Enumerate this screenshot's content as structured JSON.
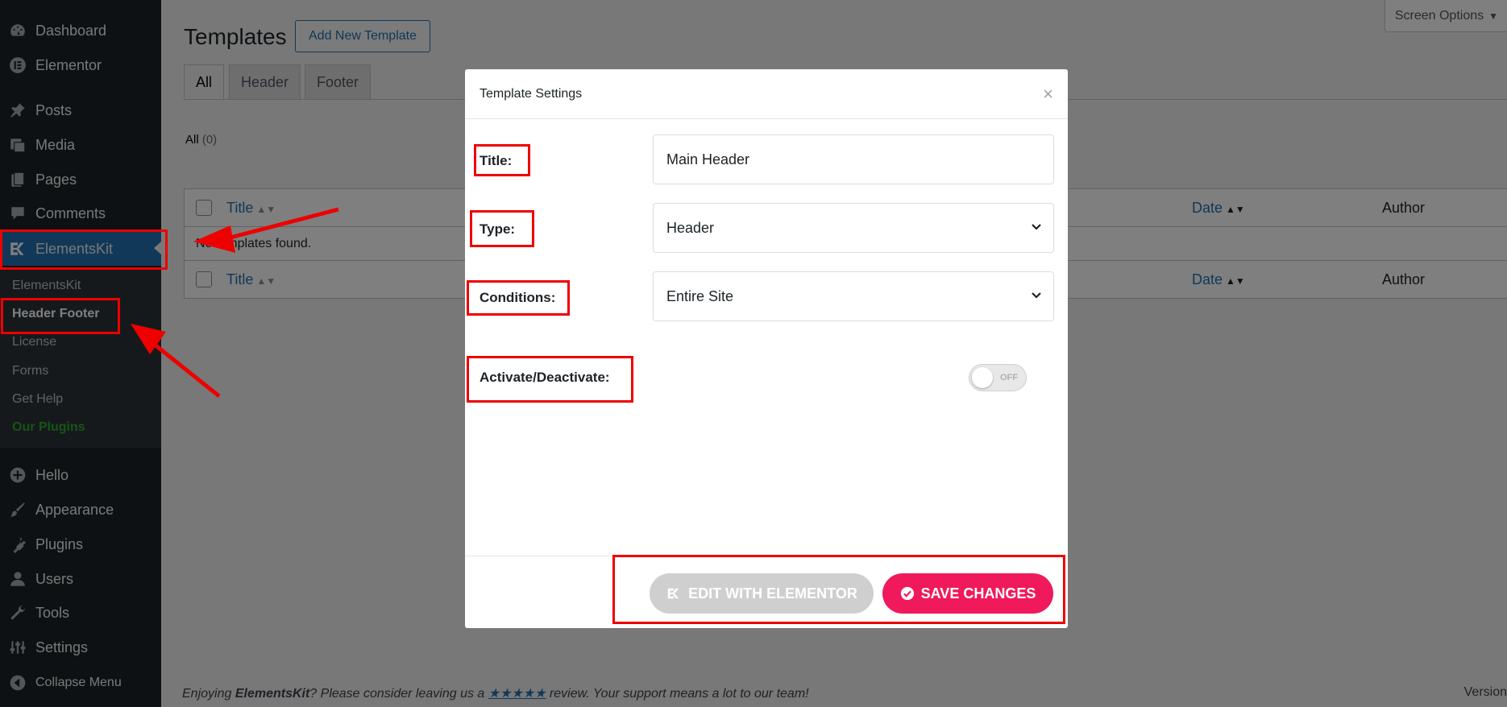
{
  "sidebar": {
    "items": [
      {
        "label": "Dashboard",
        "icon": "dashboard-icon"
      },
      {
        "label": "Elementor",
        "icon": "elementor-icon"
      },
      {
        "label": "Posts",
        "icon": "pin-icon"
      },
      {
        "label": "Media",
        "icon": "media-icon"
      },
      {
        "label": "Pages",
        "icon": "pages-icon"
      },
      {
        "label": "Comments",
        "icon": "comment-icon"
      },
      {
        "label": "ElementsKit",
        "icon": "elementskit-icon"
      },
      {
        "label": "Hello",
        "icon": "plus-circle-icon"
      },
      {
        "label": "Appearance",
        "icon": "brush-icon"
      },
      {
        "label": "Plugins",
        "icon": "plugin-icon"
      },
      {
        "label": "Users",
        "icon": "user-icon"
      },
      {
        "label": "Tools",
        "icon": "wrench-icon"
      },
      {
        "label": "Settings",
        "icon": "sliders-icon"
      },
      {
        "label": "Collapse Menu",
        "icon": "collapse-icon"
      }
    ],
    "submenu": [
      "ElementsKit",
      "Header Footer",
      "License",
      "Forms",
      "Get Help",
      "Our Plugins"
    ]
  },
  "page": {
    "title": "Templates",
    "add_new": "Add New Template",
    "screen_options": "Screen Options",
    "tabs": [
      "All",
      "Header",
      "Footer"
    ],
    "all_label": "All",
    "all_count": "(0)",
    "columns": {
      "title": "Title",
      "date": "Date",
      "author": "Author"
    },
    "empty": "No templates found.",
    "footer_pre": "Enjoying ",
    "footer_brand": "ElementsKit",
    "footer_mid": "? Please consider leaving us a ",
    "footer_stars": "★★★★★",
    "footer_post": " review. Your support means a lot to our team!",
    "version": "Version"
  },
  "modal": {
    "title": "Template Settings",
    "close": "×",
    "fields": {
      "title_label": "Title:",
      "title_value": "Main Header",
      "type_label": "Type:",
      "type_value": "Header",
      "conditions_label": "Conditions:",
      "conditions_value": "Entire Site",
      "activate_label": "Activate/Deactivate:",
      "toggle_state": "OFF"
    },
    "edit_button": "EDIT WITH ELEMENTOR",
    "save_button": "SAVE CHANGES"
  },
  "colors": {
    "sidebar_bg": "#1d2327",
    "accent": "#2271b1",
    "save": "#f0195b",
    "annotation": "#ee0000"
  }
}
